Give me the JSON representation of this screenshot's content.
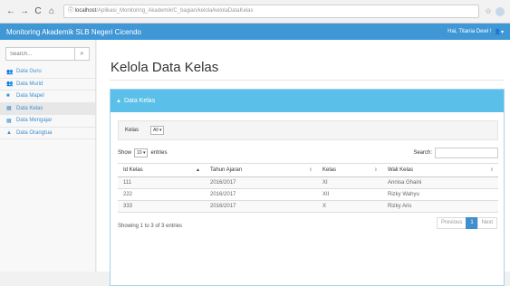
{
  "browser": {
    "back_icon": "←",
    "forward_icon": "→",
    "reload_icon": "C",
    "home_icon": "⌂",
    "url_host": "ⓘ localhost",
    "url_path": "/Aplikasi_Monitoring_Akademik/C_bagian/kelola/kelolaDataKelas"
  },
  "app": {
    "brand": "Monitoring Akademik SLB Negeri Cicendo",
    "user": "Hai, Titania Dewi !",
    "accent": "#3f97d6"
  },
  "sidebar": {
    "search_placeholder": "Search...",
    "search_icon": "⌕",
    "items": [
      {
        "label": "Data Guru",
        "icon": "users-icon"
      },
      {
        "label": "Data Murid",
        "icon": "users-icon"
      },
      {
        "label": "Data Mapel",
        "icon": "book-icon"
      },
      {
        "label": "Data Kelas",
        "icon": "table-icon"
      },
      {
        "label": "Data Mengajar",
        "icon": "table-icon"
      },
      {
        "label": "Data Orangtua",
        "icon": "user-icon"
      }
    ]
  },
  "main": {
    "title": "Kelola Data Kelas",
    "panel_title": "Data Kelas",
    "filter_label": "Kelas",
    "filter_value": "All ▾",
    "show_label": "Show",
    "entries_value": "10 ▾",
    "entries_label": "entries",
    "search_label": "Search:",
    "table": {
      "headers": [
        "Id Kelas",
        "Tahun Ajaran",
        "Kelas",
        "Wali Kelas"
      ],
      "rows": [
        [
          "111",
          "2016/2017",
          "XI",
          "Annisa Ghaini"
        ],
        [
          "222",
          "2016/2017",
          "XII",
          "Rizky Wahyu"
        ],
        [
          "333",
          "2016/2017",
          "X",
          "Rizky Aris"
        ]
      ]
    },
    "info": "Showing 1 to 3 of 3 entries",
    "pagination": {
      "previous": "Previous",
      "current": "1",
      "next": "Next"
    }
  }
}
